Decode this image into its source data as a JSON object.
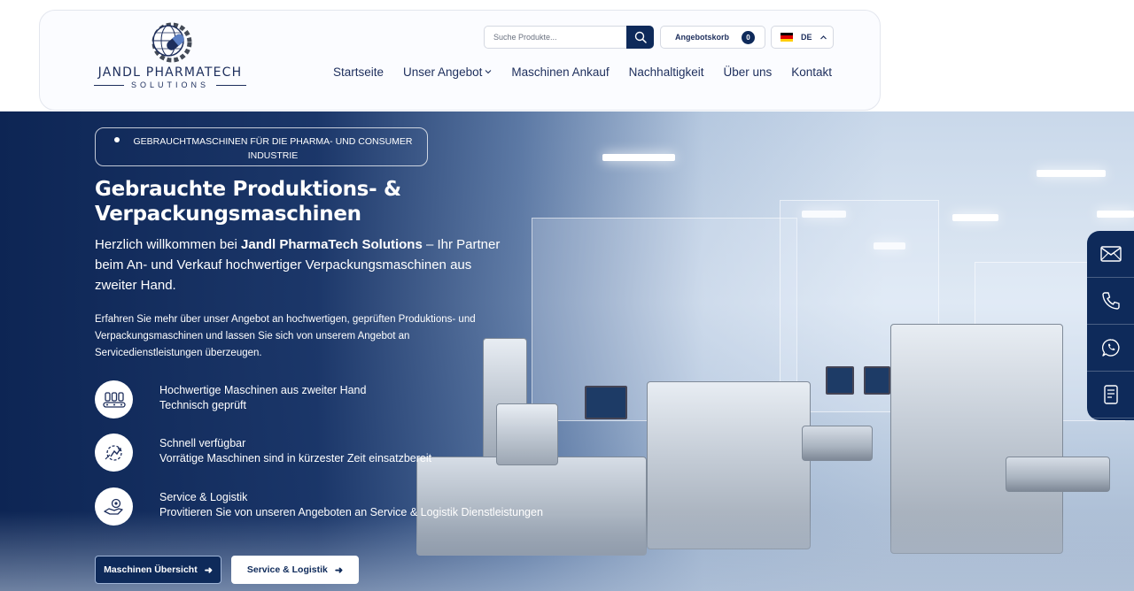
{
  "colors": {
    "brand_navy": "#0e2a5a",
    "text_navy": "#1d2e5c",
    "white": "#ffffff"
  },
  "header": {
    "logo": {
      "name": "JANDL PHARMATECH",
      "sub": "SOLUTIONS",
      "icon": "pill-globe-gear-icon"
    },
    "search": {
      "placeholder": "Suche Produkte...",
      "value": "",
      "icon": "search-icon"
    },
    "cart": {
      "label": "Angebotskorb",
      "count": "0"
    },
    "language": {
      "selected": "DE",
      "flag": "germany-flag",
      "icon": "chevron-up-icon"
    },
    "nav": [
      {
        "label": "Startseite"
      },
      {
        "label": "Unser Angebot",
        "has_dropdown": true
      },
      {
        "label": "Maschinen Ankauf"
      },
      {
        "label": "Nachhaltigkeit"
      },
      {
        "label": "Über uns"
      },
      {
        "label": "Kontakt"
      }
    ]
  },
  "hero": {
    "tagline": "GEBRAUCHTMASCHINEN FÜR DIE PHARMA- UND CONSUMER INDUSTRIE",
    "title": "Gebrauchte Produktions- & Verpackungsmaschinen",
    "intro_prefix": "Herzlich willkommen bei ",
    "intro_brand": "Jandl PharmaTech Solutions",
    "intro_suffix": " – Ihr Partner beim An- und Verkauf hochwertiger Verpackungsmaschinen aus zweiter Hand.",
    "description": "Erfahren Sie mehr über unser Angebot an hochwertigen, geprüften Produktions- und Verpackungsmaschinen und lassen Sie sich von unserem Angebot an Servicedienstleistungen überzeugen.",
    "features": [
      {
        "icon": "conveyor-bottles-icon",
        "title": "Hochwertige Maschinen aus zweiter Hand",
        "text": "Technisch geprüft"
      },
      {
        "icon": "fast-delivery-icon",
        "title": "Schnell verfügbar",
        "text": "Vorrätige Maschinen sind in kürzester Zeit einsatzbereit"
      },
      {
        "icon": "service-hand-icon",
        "title": "Service & Logistik",
        "text": "Provitieren Sie von unseren Angeboten an Service & Logistik Dienstleistungen"
      }
    ],
    "buttons": {
      "primary": "Maschinen Übersicht",
      "secondary": "Service & Logistik",
      "arrow": "➜"
    }
  },
  "contact_sidebar": [
    {
      "icon": "mail-icon"
    },
    {
      "icon": "phone-icon"
    },
    {
      "icon": "whatsapp-icon"
    },
    {
      "icon": "document-icon"
    }
  ]
}
